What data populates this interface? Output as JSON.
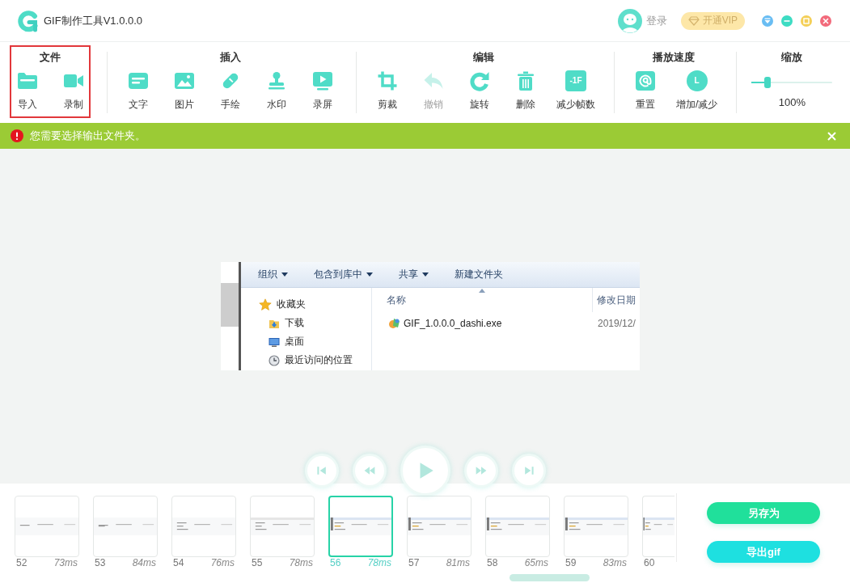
{
  "window": {
    "title": "GIF制作工具V1.0.0.0",
    "login": "登录",
    "vip": "开通VIP"
  },
  "toolbar": {
    "groups": [
      {
        "kind": "buttons",
        "title": "文件",
        "highlighted": true,
        "items": [
          {
            "kind": "icon",
            "label": "导入",
            "disabled": false
          },
          {
            "kind": "icon",
            "label": "录制",
            "disabled": false
          }
        ]
      },
      {
        "kind": "buttons",
        "title": "插入",
        "highlighted": false,
        "items": [
          {
            "kind": "icon",
            "label": "文字",
            "disabled": false
          },
          {
            "kind": "icon",
            "label": "图片",
            "disabled": false
          },
          {
            "kind": "icon",
            "label": "手绘",
            "disabled": false
          },
          {
            "kind": "icon",
            "label": "水印",
            "disabled": false
          },
          {
            "kind": "icon",
            "label": "录屏",
            "disabled": false
          }
        ]
      },
      {
        "kind": "buttons",
        "title": "编辑",
        "highlighted": false,
        "items": [
          {
            "kind": "icon",
            "label": "剪裁",
            "disabled": false
          },
          {
            "kind": "icon",
            "label": "撤销",
            "disabled": true
          },
          {
            "kind": "icon",
            "label": "旋转",
            "disabled": false
          },
          {
            "kind": "icon",
            "label": "删除",
            "disabled": false
          },
          {
            "kind": "tile",
            "badge": "-1F",
            "label": "减少帧数",
            "disabled": false
          }
        ]
      },
      {
        "kind": "buttons",
        "title": "播放速度",
        "highlighted": false,
        "items": [
          {
            "kind": "icon",
            "label": "重置",
            "disabled": false
          },
          {
            "kind": "disc",
            "badge": "L",
            "label": "增加/减少",
            "disabled": false
          }
        ]
      },
      {
        "kind": "slider",
        "title": "缩放",
        "highlighted": false,
        "level": 0.2,
        "reading": "100%"
      }
    ]
  },
  "alert": {
    "message": "您需要选择输出文件夹。"
  },
  "preview": {
    "toolbar": [
      {
        "label": "组织",
        "dropdown": true
      },
      {
        "label": "包含到库中",
        "dropdown": true
      },
      {
        "label": "共享",
        "dropdown": true
      },
      {
        "label": "新建文件夹",
        "dropdown": false
      }
    ],
    "nav": [
      {
        "label": "收藏夹",
        "children": [
          {
            "label": "下载"
          },
          {
            "label": "桌面"
          },
          {
            "label": "最近访问的位置"
          }
        ]
      }
    ],
    "columns": [
      {
        "label": "名称",
        "sorted": true
      },
      {
        "label": "修改日期",
        "sorted": false
      }
    ],
    "files": [
      {
        "name": "GIF_1.0.0.0_dashi.exe",
        "date": "2019/12/"
      }
    ]
  },
  "frames": [
    {
      "number": "52",
      "duration": "73ms",
      "selected": false
    },
    {
      "number": "53",
      "duration": "84ms",
      "selected": false
    },
    {
      "number": "54",
      "duration": "76ms",
      "selected": false
    },
    {
      "number": "55",
      "duration": "78ms",
      "selected": false
    },
    {
      "number": "56",
      "duration": "78ms",
      "selected": true
    },
    {
      "number": "57",
      "duration": "81ms",
      "selected": false
    },
    {
      "number": "58",
      "duration": "65ms",
      "selected": false
    },
    {
      "number": "59",
      "duration": "83ms",
      "selected": false
    },
    {
      "number": "60",
      "selected": false
    }
  ],
  "actions": [
    {
      "kind": "save",
      "label": "另存为"
    },
    {
      "kind": "export",
      "label": "导出gif"
    }
  ]
}
